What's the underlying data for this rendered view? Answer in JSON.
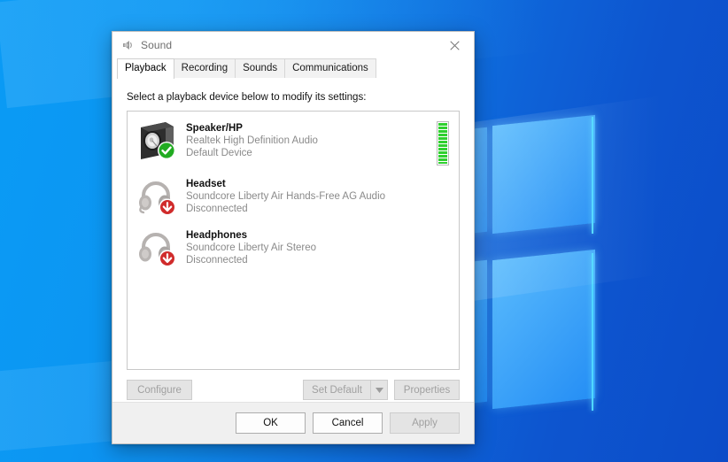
{
  "window": {
    "title": "Sound",
    "title_icon": "speaker-icon",
    "close_icon": "close-icon"
  },
  "tabs": [
    {
      "label": "Playback",
      "active": true
    },
    {
      "label": "Recording",
      "active": false
    },
    {
      "label": "Sounds",
      "active": false
    },
    {
      "label": "Communications",
      "active": false
    }
  ],
  "playback": {
    "prompt": "Select a playback device below to modify its settings:",
    "devices": [
      {
        "icon": "speaker-box-icon",
        "badge": "green-check-badge",
        "name": "Speaker/HP",
        "description": "Realtek High Definition Audio",
        "status": "Default Device",
        "meter": true,
        "meter_level": 100
      },
      {
        "icon": "headset-icon",
        "badge": "red-down-arrow-badge",
        "name": "Headset",
        "description": "Soundcore Liberty Air Hands-Free AG Audio",
        "status": "Disconnected",
        "meter": false,
        "meter_level": 0
      },
      {
        "icon": "headphones-icon",
        "badge": "red-down-arrow-badge",
        "name": "Headphones",
        "description": "Soundcore Liberty Air Stereo",
        "status": "Disconnected",
        "meter": false,
        "meter_level": 0
      }
    ],
    "buttons": {
      "configure": "Configure",
      "set_default": "Set Default",
      "set_default_arrow": "chevron-down-icon",
      "properties": "Properties"
    }
  },
  "footer": {
    "ok": "OK",
    "cancel": "Cancel",
    "apply": "Apply"
  },
  "colors": {
    "accent_green": "#2fd02f",
    "badge_red": "#d13030",
    "desktop_blue": "#0a9bf5",
    "dialog_bg": "#f0f0f0"
  }
}
